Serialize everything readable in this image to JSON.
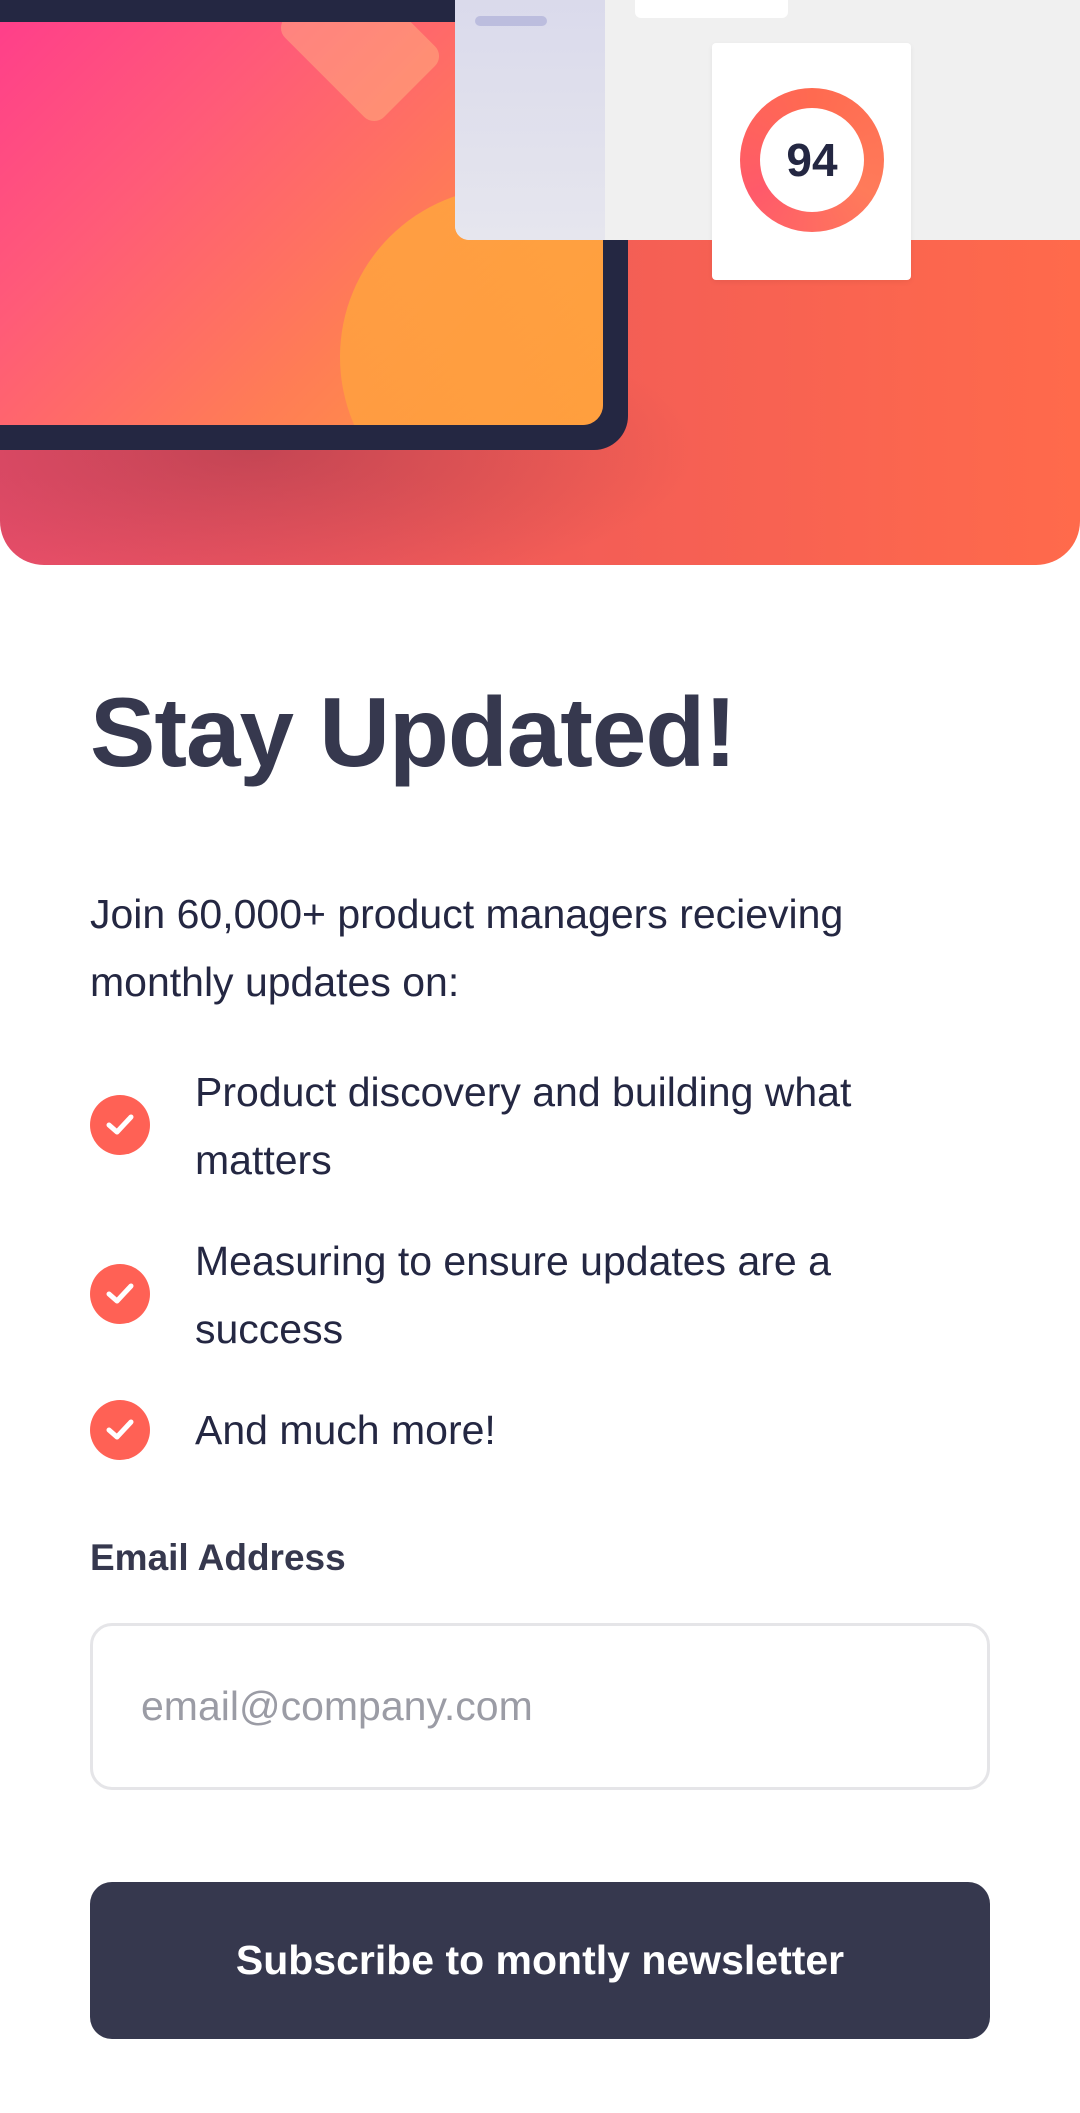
{
  "hero": {
    "score_value": "94"
  },
  "content": {
    "title": "Stay Updated!",
    "intro": "Join 60,000+ product managers recieving monthly updates on:",
    "features": [
      "Product discovery and building what matters",
      "Measuring to ensure updates are a success",
      "And much more!"
    ]
  },
  "form": {
    "email_label": "Email Address",
    "email_placeholder": "email@company.com",
    "email_value": "",
    "subscribe_label": "Subscribe to montly newsletter"
  },
  "icons": {
    "feature_bullet": "check-icon"
  },
  "colors": {
    "accent": "#ff6155",
    "dark": "#242742",
    "button": "#36384e",
    "hero_gradient_start": "#ff3f8a",
    "hero_gradient_end": "#ff6a4b"
  }
}
